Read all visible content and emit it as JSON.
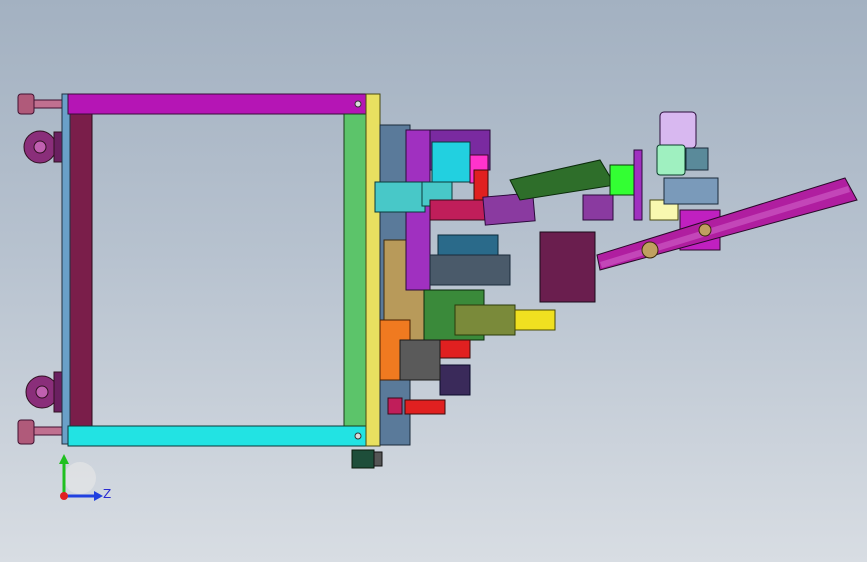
{
  "viewport": {
    "background_top": "#a3b1c1",
    "background_bottom": "#d8dde3"
  },
  "model": {
    "colors": {
      "frame_top_rail": "#b515b5",
      "frame_bottom_rail": "#22e3e3",
      "frame_left_post": "#7a1e4a",
      "frame_right_post": "#5cc46a",
      "yellow_plate": "#e8e060",
      "purple_arm": "#a030c0",
      "conveyor_belt": "#b01ea0",
      "dark_box": "#6a1e4e",
      "green_chute": "#2e6e2a",
      "lime_block": "#33ff33",
      "cylinder_lavender": "#d8b8f0",
      "cylinder_mint": "#9ff0c0",
      "caster": "#8a2e7a",
      "leveling_foot": "#b05a7a",
      "motor_green": "#1e4e3a",
      "tan_block": "#b89a5a",
      "orange_block": "#f07a20",
      "red_block": "#e02020",
      "yellow_motor": "#f0e020",
      "olive_motor": "#7a8a3a",
      "cyan_block": "#22d0e0",
      "magenta_block": "#ff33cc"
    }
  },
  "triad": {
    "y_axis_color": "#20c020",
    "z_axis_color": "#2040e0",
    "x_axis_color": "#e02020",
    "z_label": "Z"
  }
}
